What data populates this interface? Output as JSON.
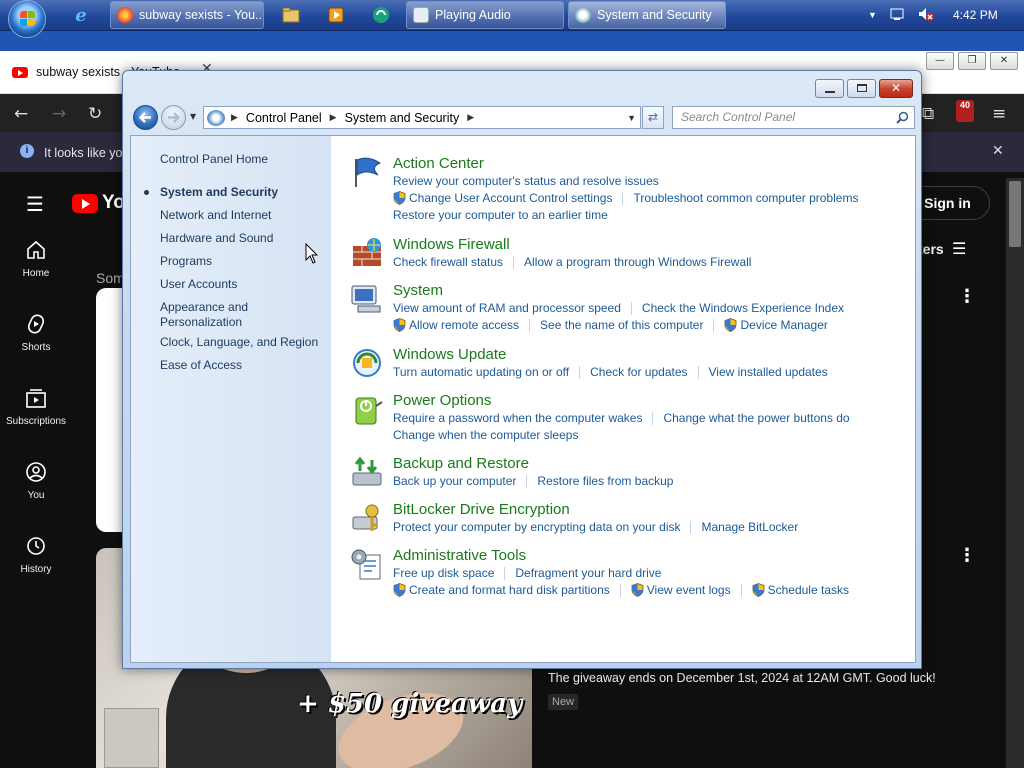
{
  "taskbar": {
    "tasks": [
      {
        "label": "subway sexists - You...",
        "icon": "firefox-icon"
      },
      {
        "label": "Playing Audio",
        "icon": "audio-icon"
      },
      {
        "label": "System and Security",
        "icon": "control-panel-icon"
      }
    ],
    "clock": "4:42 PM"
  },
  "browser": {
    "tab_title": "subway sexists - YouTube",
    "infobar_text": "It looks like you",
    "extension_badge": "40",
    "sign_in": "Sign in",
    "filters_label": "ters",
    "partial_text": "Som",
    "sidebar": [
      {
        "label": "Home",
        "icon": "home-icon"
      },
      {
        "label": "Shorts",
        "icon": "shorts-icon"
      },
      {
        "label": "Subscriptions",
        "icon": "subscriptions-icon"
      },
      {
        "label": "You",
        "icon": "you-icon"
      },
      {
        "label": "History",
        "icon": "history-icon"
      }
    ],
    "thumbnail_text": "+ $50 giveaway",
    "video_desc": "The giveaway ends on December 1st, 2024 at 12AM GMT. Good luck!",
    "new_badge": "New"
  },
  "control_panel": {
    "breadcrumb": [
      "Control Panel",
      "System and Security"
    ],
    "search_placeholder": "Search Control Panel",
    "nav": [
      {
        "label": "Control Panel Home"
      },
      {
        "label": "System and Security",
        "current": true
      },
      {
        "label": "Network and Internet"
      },
      {
        "label": "Hardware and Sound"
      },
      {
        "label": "Programs"
      },
      {
        "label": "User Accounts"
      },
      {
        "label": "Appearance and Personalization"
      },
      {
        "label": "Clock, Language, and Region"
      },
      {
        "label": "Ease of Access"
      }
    ],
    "categories": [
      {
        "title": "Action Center",
        "icon": "action-center-flag-icon",
        "rows": [
          [
            {
              "t": "Review your computer's status and resolve issues"
            }
          ],
          [
            {
              "t": "Change User Account Control settings",
              "shield": true
            },
            {
              "t": "Troubleshoot common computer problems"
            }
          ],
          [
            {
              "t": "Restore your computer to an earlier time"
            }
          ]
        ]
      },
      {
        "title": "Windows Firewall",
        "icon": "firewall-icon",
        "rows": [
          [
            {
              "t": "Check firewall status"
            },
            {
              "t": "Allow a program through Windows Firewall"
            }
          ]
        ]
      },
      {
        "title": "System",
        "icon": "system-computer-icon",
        "rows": [
          [
            {
              "t": "View amount of RAM and processor speed"
            },
            {
              "t": "Check the Windows Experience Index"
            }
          ],
          [
            {
              "t": "Allow remote access",
              "shield": true
            },
            {
              "t": "See the name of this computer"
            },
            {
              "t": "Device Manager",
              "shield": true
            }
          ]
        ]
      },
      {
        "title": "Windows Update",
        "icon": "windows-update-icon",
        "rows": [
          [
            {
              "t": "Turn automatic updating on or off"
            },
            {
              "t": "Check for updates"
            },
            {
              "t": "View installed updates"
            }
          ]
        ]
      },
      {
        "title": "Power Options",
        "icon": "power-options-icon",
        "rows": [
          [
            {
              "t": "Require a password when the computer wakes"
            },
            {
              "t": "Change what the power buttons do"
            }
          ],
          [
            {
              "t": "Change when the computer sleeps"
            }
          ]
        ]
      },
      {
        "title": "Backup and Restore",
        "icon": "backup-restore-icon",
        "rows": [
          [
            {
              "t": "Back up your computer"
            },
            {
              "t": "Restore files from backup"
            }
          ]
        ]
      },
      {
        "title": "BitLocker Drive Encryption",
        "icon": "bitlocker-icon",
        "rows": [
          [
            {
              "t": "Protect your computer by encrypting data on your disk"
            },
            {
              "t": "Manage BitLocker"
            }
          ]
        ]
      },
      {
        "title": "Administrative Tools",
        "icon": "administrative-tools-icon",
        "rows": [
          [
            {
              "t": "Free up disk space"
            },
            {
              "t": "Defragment your hard drive"
            }
          ],
          [
            {
              "t": "Create and format hard disk partitions",
              "shield": true
            },
            {
              "t": "View event logs",
              "shield": true
            },
            {
              "t": "Schedule tasks",
              "shield": true
            }
          ]
        ]
      }
    ]
  }
}
